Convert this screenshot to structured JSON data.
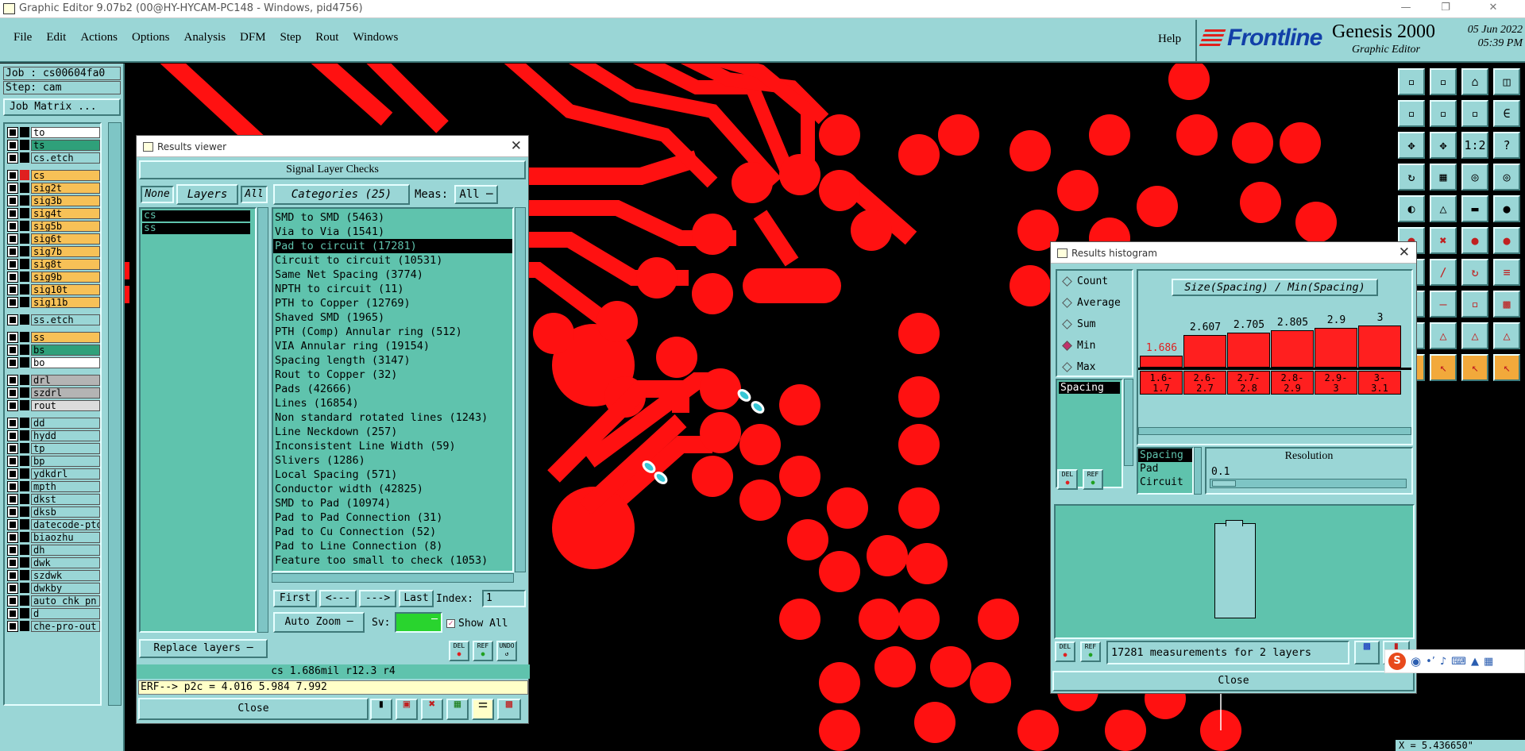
{
  "window": {
    "title": "Graphic Editor 9.07b2 (00@HY-HYCAM-PC148 - Windows, pid4756)"
  },
  "menu": [
    "File",
    "Edit",
    "Actions",
    "Options",
    "Analysis",
    "DFM",
    "Step",
    "Rout",
    "Windows"
  ],
  "help_label": "Help",
  "brand": {
    "logo": "Frontline",
    "product": "Genesis 2000",
    "subtitle": "Graphic Editor",
    "date": "05 Jun 2022",
    "time": "05:39 PM"
  },
  "job": {
    "job_line": "Job : cs00604fa0",
    "step_line": "Step: cam",
    "job_matrix_label": "Job Matrix ..."
  },
  "layers": [
    {
      "name": "to",
      "color": "#ffffff"
    },
    {
      "name": "ts",
      "color": "#2fa07a"
    },
    {
      "name": "cs.etch",
      "color": "#9ad6d6"
    },
    {
      "name": "cs",
      "color": "#f7c157",
      "active": true
    },
    {
      "name": "sig2t",
      "color": "#f7c157"
    },
    {
      "name": "sig3b",
      "color": "#f7c157"
    },
    {
      "name": "sig4t",
      "color": "#f7c157"
    },
    {
      "name": "sig5b",
      "color": "#f7c157"
    },
    {
      "name": "sig6t",
      "color": "#f7c157"
    },
    {
      "name": "sig7b",
      "color": "#f7c157"
    },
    {
      "name": "sig8t",
      "color": "#f7c157"
    },
    {
      "name": "sig9b",
      "color": "#f7c157"
    },
    {
      "name": "sig10t",
      "color": "#f7c157"
    },
    {
      "name": "sig11b",
      "color": "#f7c157"
    },
    {
      "name": "ss.etch",
      "color": "#9ad6d6"
    },
    {
      "name": "ss",
      "color": "#f7c157"
    },
    {
      "name": "bs",
      "color": "#2fa07a"
    },
    {
      "name": "bo",
      "color": "#ffffff"
    },
    {
      "name": "drl",
      "color": "#b4b4b4"
    },
    {
      "name": "szdrl",
      "color": "#b4b4b4"
    },
    {
      "name": "rout",
      "color": "#dcdcdc"
    },
    {
      "name": "dd",
      "color": "#9ad6d6"
    },
    {
      "name": "hydd",
      "color": "#9ad6d6"
    },
    {
      "name": "tp",
      "color": "#9ad6d6"
    },
    {
      "name": "bp",
      "color": "#9ad6d6"
    },
    {
      "name": "ydkdrl",
      "color": "#9ad6d6"
    },
    {
      "name": "mpth",
      "color": "#9ad6d6"
    },
    {
      "name": "dkst",
      "color": "#9ad6d6"
    },
    {
      "name": "dksb",
      "color": "#9ad6d6"
    },
    {
      "name": "datecode-pto",
      "color": "#9ad6d6"
    },
    {
      "name": "biaozhu",
      "color": "#9ad6d6"
    },
    {
      "name": "dh",
      "color": "#9ad6d6"
    },
    {
      "name": "dwk",
      "color": "#9ad6d6"
    },
    {
      "name": "szdwk",
      "color": "#9ad6d6"
    },
    {
      "name": "dwkby",
      "color": "#9ad6d6"
    },
    {
      "name": "auto_chk_pn",
      "color": "#9ad6d6"
    },
    {
      "name": "d",
      "color": "#9ad6d6"
    },
    {
      "name": "che-pro-out",
      "color": "#9ad6d6"
    }
  ],
  "results_viewer": {
    "title": "Results viewer",
    "header": "Signal Layer Checks",
    "none_label": "None",
    "layers_label": "Layers",
    "all_label": "All",
    "categories_label": "Categories (25)",
    "meas_label": "Meas:",
    "meas_value": "All",
    "layer_list": [
      "cs",
      "ss"
    ],
    "categories": [
      "SMD to SMD (5463)",
      "Via to Via (1541)",
      "Pad to circuit (17281)",
      "Circuit to circuit (10531)",
      "Same Net Spacing (3774)",
      "NPTH to circuit (11)",
      "PTH to Copper (12769)",
      "Shaved SMD (1965)",
      "PTH (Comp) Annular ring (512)",
      "VIA Annular ring (19154)",
      "Spacing length (3147)",
      "Rout to Copper (32)",
      "Pads (42666)",
      "Lines (16854)",
      "Non standard rotated lines (1243)",
      "Line Neckdown (257)",
      "Inconsistent Line Width (59)",
      "Slivers (1286)",
      "Local Spacing (571)",
      "Conductor width (42825)",
      "SMD to Pad (10974)",
      "Pad to Pad Connection (31)",
      "Pad to Cu Connection (52)",
      "Pad to Line Connection (8)",
      "Feature too small to check (1053)"
    ],
    "selected_index": 2,
    "nav": {
      "first": "First",
      "prev": "<---",
      "next": "--->",
      "last": "Last",
      "index_label": "Index:",
      "index_value": "1"
    },
    "auto_zoom": "Auto Zoom",
    "sv_label": "Sv:",
    "show_all": "Show All",
    "replace_layers": "Replace layers",
    "del": "DEL",
    "ref": "REF",
    "undo": "UNDO",
    "status": "cs 1.686mil  r12.3  r4",
    "erf": "ERF--> p2c = 4.016 5.984 7.992",
    "close": "Close"
  },
  "histogram": {
    "title": "Results histogram",
    "options": [
      "Count",
      "Average",
      "Sum",
      "Min",
      "Max"
    ],
    "selected_option": "Min",
    "chart_title": "Size(Spacing) / Min(Spacing)",
    "bars": [
      {
        "value": "1.686",
        "range": "1.6-\n1.7",
        "level": 0.25,
        "highlight": true
      },
      {
        "value": "2.607",
        "range": "2.6-\n2.7",
        "level": 0.68
      },
      {
        "value": "2.705",
        "range": "2.7-\n2.8",
        "level": 0.73
      },
      {
        "value": "2.805",
        "range": "2.8-\n2.9",
        "level": 0.78
      },
      {
        "value": "2.9",
        "range": "2.9-\n3",
        "level": 0.83
      },
      {
        "value": "3",
        "range": "3-\n3.1",
        "level": 0.88
      }
    ],
    "list_item": "Spacing",
    "types": [
      "Spacing",
      "Pad",
      "Circuit"
    ],
    "resolution_label": "Resolution",
    "resolution_value": "0.1",
    "del": "DEL",
    "ref": "REF",
    "summary": "17281 measurements for 2 layers",
    "close": "Close"
  },
  "coords": "X = 5.436650\"",
  "colors": {
    "panel": "#9ad6d6",
    "list": "#5fc3ad",
    "copper": "#ff1111",
    "layer_yellow": "#f7c157"
  }
}
